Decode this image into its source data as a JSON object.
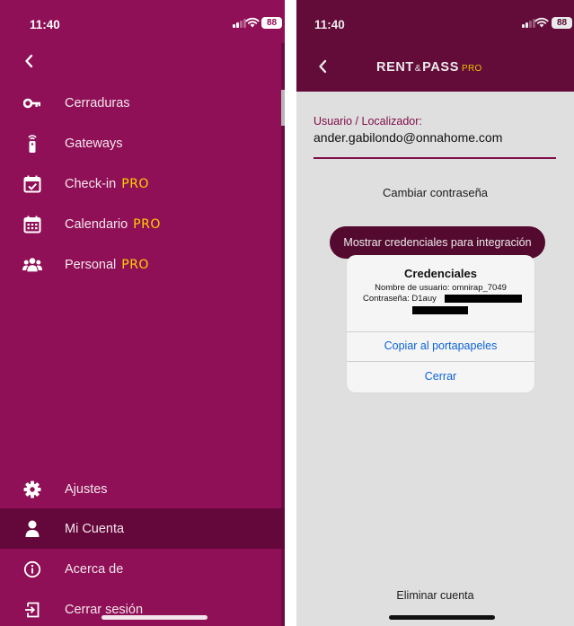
{
  "status_bar": {
    "time": "11:40",
    "battery": "88"
  },
  "menu": {
    "items": [
      {
        "label": "Cerraduras",
        "pro": "",
        "icon": "key-icon"
      },
      {
        "label": "Gateways",
        "pro": "",
        "icon": "gateway-remote-icon"
      },
      {
        "label": "Check-in ",
        "pro": "PRO",
        "icon": "calendar-check-icon"
      },
      {
        "label": "Calendario ",
        "pro": "PRO",
        "icon": "calendar-grid-icon"
      },
      {
        "label": "Personal ",
        "pro": "PRO",
        "icon": "people-icon"
      }
    ],
    "bottom_items": [
      {
        "label": "Ajustes",
        "icon": "gear-icon"
      },
      {
        "label": "Mi Cuenta",
        "icon": "person-icon",
        "active": true
      },
      {
        "label": "Acerca de",
        "icon": "info-icon"
      },
      {
        "label": "Cerrar sesión",
        "icon": "logout-icon"
      }
    ]
  },
  "account": {
    "logo": {
      "part1": "RENT",
      "amp": "&",
      "part2": "PASS",
      "pro": "PRO"
    },
    "user_label": "Usuario / Localizador:",
    "user_value": "ander.gabilondo@onnahome.com",
    "change_password": "Cambiar contraseña",
    "show_credentials": "Mostrar credenciales para integración",
    "delete_account": "Eliminar cuenta"
  },
  "alert": {
    "title": "Credenciales",
    "username_line": "Nombre de usuario: omnirap_7049",
    "password_line": "Contraseña: D1auy",
    "copy_button": "Copiar al portapapeles",
    "close_button": "Cerrar"
  },
  "colors": {
    "menu_bg": "#8f1056",
    "menu_active": "#64073a",
    "header_bg": "#6c0c3e",
    "accent_pro": "#ffd200",
    "button_bg": "#5c0b34",
    "link_blue": "#0a64d6"
  }
}
